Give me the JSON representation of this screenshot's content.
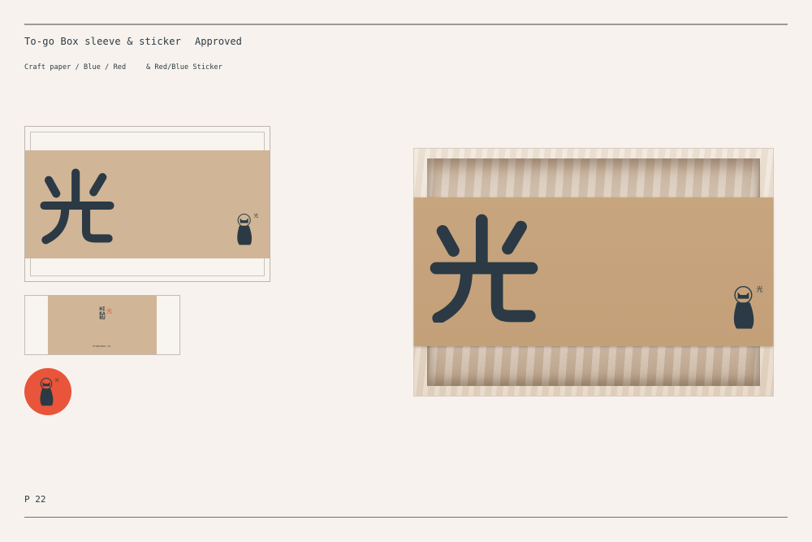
{
  "header": {
    "title": "To-go Box sleeve & sticker",
    "status": "Approved",
    "spec_material": "Craft paper / Blue / Red",
    "spec_sticker": "& Red/Blue Sticker"
  },
  "footer": {
    "page_number": "P 22"
  },
  "artwork": {
    "kanji": "光",
    "vertical_wordmark": "HIKARU",
    "vertical_mark": "光",
    "caption": "STUDIOKO CO."
  },
  "colors": {
    "background": "#f7f2ed",
    "kraft": "#d1b597",
    "kraft_mockup": "#c4a079",
    "navy": "#2b3a45",
    "accent_red": "#e8553a"
  }
}
